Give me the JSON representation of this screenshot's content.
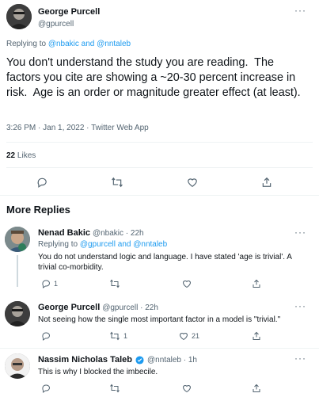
{
  "main_tweet": {
    "author_name": "George Purcell",
    "author_handle": "@gpurcell",
    "replying_prefix": "Replying to",
    "replying_to": "@nbakic and @nntaleb",
    "text": "You don't understand the study you are reading.  The factors you cite are showing a ~20-30 percent increase in risk.  Age is an order or magnitude greater effect (at least).",
    "timestamp": "3:26 PM · Jan 1, 2022 · Twitter Web App",
    "likes_count": "22",
    "likes_label": "Likes"
  },
  "section_title": "More Replies",
  "replies": [
    {
      "author_name": "Nenad Bakic",
      "author_handle": "@nbakic · 22h",
      "replying_prefix": "Replying to",
      "replying_to": "@gpurcell and @nntaleb",
      "text": "You do not understand logic and language. I have stated 'age is trivial'. A trivial co-morbidity.",
      "reply_count": "1",
      "retweet_count": "",
      "like_count": ""
    },
    {
      "author_name": "George Purcell",
      "author_handle": "@gpurcell · 22h",
      "text": "Not seeing how the single most important factor in a model is \"trivial.\"",
      "reply_count": "",
      "retweet_count": "1",
      "like_count": "21"
    },
    {
      "author_name": "Nassim Nicholas Taleb",
      "author_handle": "@nntaleb · 1h",
      "text": "This is why I blocked the imbecile."
    }
  ],
  "colors": {
    "link": "#1d9bf0",
    "muted": "#536471",
    "verified": "#1d9bf0"
  }
}
